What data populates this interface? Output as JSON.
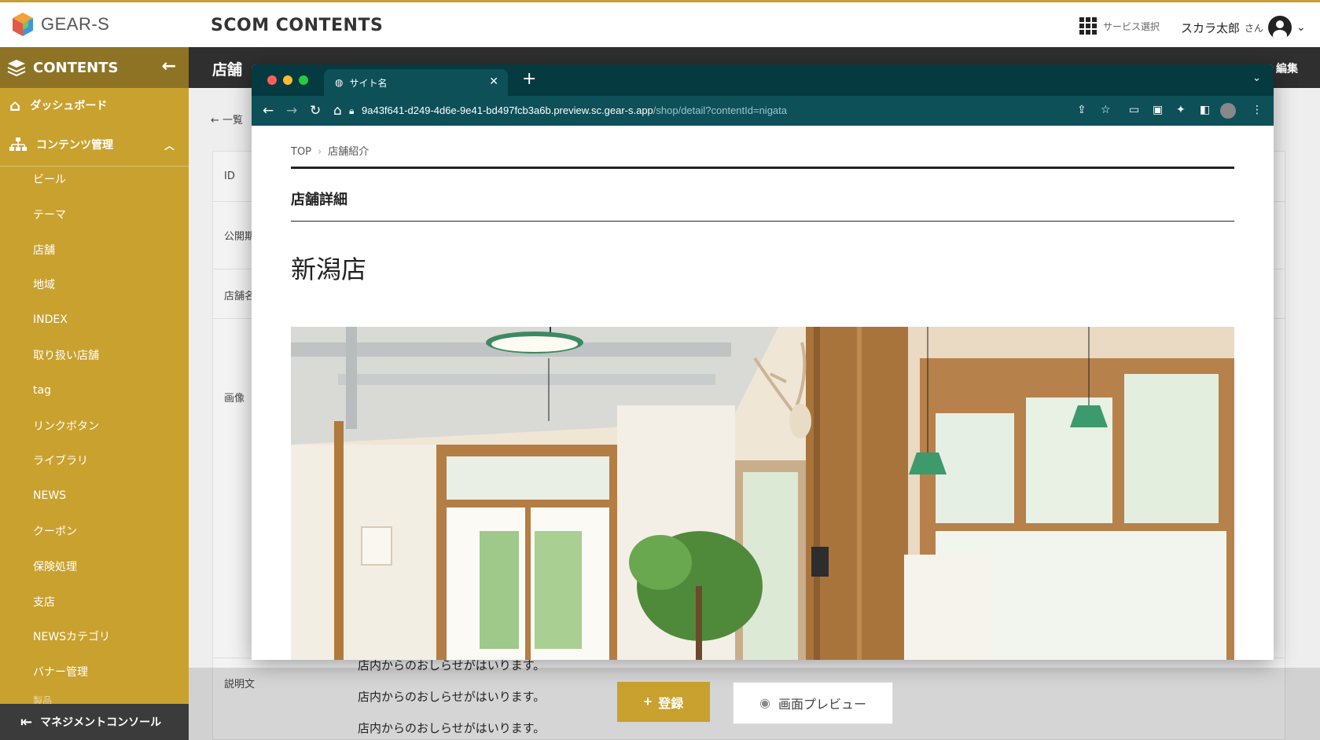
{
  "header": {
    "logo_text": "GEAR-S",
    "app_title": "SCOM CONTENTS",
    "service_select": "サービス選択",
    "user_name": "スカラ太郎",
    "user_suffix": "さん"
  },
  "sidebar": {
    "title": "CONTENTS",
    "dashboard": "ダッシュボード",
    "content_mgmt": "コンテンツ管理",
    "items": [
      "ビール",
      "テーマ",
      "店舗",
      "地域",
      "INDEX",
      "取り扱い店舗",
      "tag",
      "リンクボタン",
      "ライブラリ",
      "NEWS",
      "クーポン",
      "保険処理",
      "支店",
      "NEWSカテゴリ",
      "バナー管理",
      "製品"
    ],
    "management_console": "マネジメントコンソール"
  },
  "page": {
    "title_partial": "店舗",
    "edit_label": "編集",
    "back_link": "← 一覧",
    "labels": {
      "id": "ID",
      "publish": "公開期",
      "store_name": "店舗名",
      "image": "画像",
      "description": "説明文"
    },
    "description_lines": [
      "店内からのおしらせがはいります。",
      "店内からのおしらせがはいります。",
      "店内からのおしらせがはいります。"
    ]
  },
  "buttons": {
    "register": "登録",
    "preview": "画面プレビュー"
  },
  "browser": {
    "tab_title": "サイト名",
    "url_host": "9a43f641-d249-4d6e-9e41-bd497fcb3a6b.preview.sc.gear-s.app",
    "url_path": "/shop/detail?contentId=nigata",
    "breadcrumb": [
      "TOP",
      "店舗紹介"
    ],
    "section_title": "店舗詳細",
    "store_name": "新潟店"
  },
  "colors": {
    "accent": "#c9a12e",
    "sidebar_dark": "#8f7325",
    "browser_chrome": "#043a40"
  }
}
